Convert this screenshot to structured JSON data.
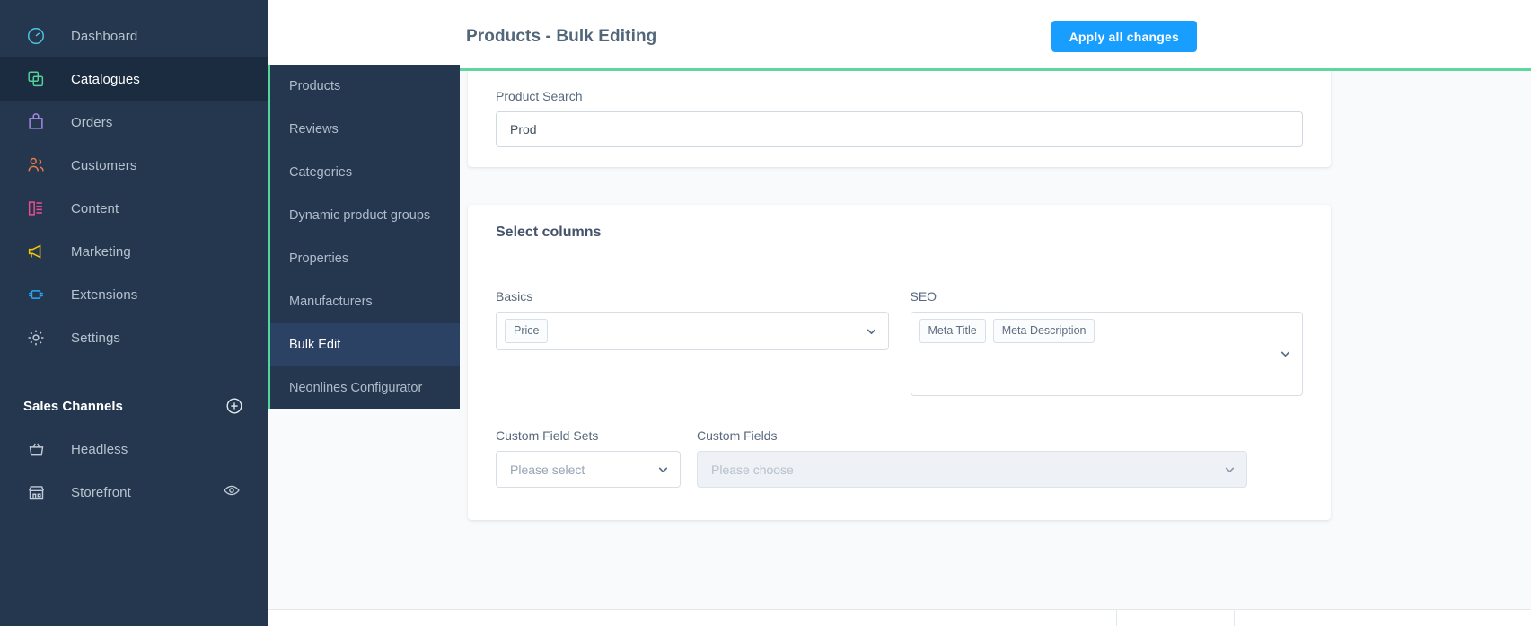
{
  "sidebar": {
    "items": [
      {
        "label": "Dashboard",
        "icon": "dashboard-icon",
        "active": false
      },
      {
        "label": "Catalogues",
        "icon": "catalogues-icon",
        "active": true
      },
      {
        "label": "Orders",
        "icon": "orders-icon",
        "active": false
      },
      {
        "label": "Customers",
        "icon": "customers-icon",
        "active": false
      },
      {
        "label": "Content",
        "icon": "content-icon",
        "active": false
      },
      {
        "label": "Marketing",
        "icon": "marketing-icon",
        "active": false
      },
      {
        "label": "Extensions",
        "icon": "extensions-icon",
        "active": false
      },
      {
        "label": "Settings",
        "icon": "gear-icon",
        "active": false
      }
    ],
    "sales_channels": {
      "title": "Sales Channels",
      "add_icon": "plus-circle-icon",
      "channels": [
        {
          "label": "Headless",
          "icon": "basket-icon",
          "trailing_icon": null
        },
        {
          "label": "Storefront",
          "icon": "storefront-icon",
          "trailing_icon": "eye-icon"
        }
      ]
    },
    "colors": {
      "background": "#24374e",
      "active": "#1c2c40",
      "accent": "#51d79c"
    }
  },
  "subnav": {
    "items": [
      {
        "label": "Products",
        "active": false
      },
      {
        "label": "Reviews",
        "active": false
      },
      {
        "label": "Categories",
        "active": false
      },
      {
        "label": "Dynamic product groups",
        "active": false
      },
      {
        "label": "Properties",
        "active": false
      },
      {
        "label": "Manufacturers",
        "active": false
      },
      {
        "label": "Bulk Edit",
        "active": true
      },
      {
        "label": "Neonlines Configurator",
        "active": false
      }
    ]
  },
  "header": {
    "title": "Products - Bulk Editing",
    "apply_label": "Apply all changes",
    "accent_color": "#5ed6a0",
    "button_color": "#189eff"
  },
  "search_card": {
    "label": "Product Search",
    "value": "Prod",
    "placeholder": ""
  },
  "columns_card": {
    "title": "Select columns",
    "basics": {
      "label": "Basics",
      "chips": [
        "Price"
      ],
      "chevron_icon": "chevron-down-icon"
    },
    "seo": {
      "label": "SEO",
      "chips": [
        "Meta Title",
        "Meta Description"
      ],
      "chevron_icon": "chevron-down-icon"
    },
    "custom_field_sets": {
      "label": "Custom Field Sets",
      "placeholder": "Please select",
      "chevron_icon": "chevron-down-icon",
      "disabled": false
    },
    "custom_fields": {
      "label": "Custom Fields",
      "placeholder": "Please choose",
      "chevron_icon": "chevron-down-icon",
      "disabled": true
    }
  }
}
